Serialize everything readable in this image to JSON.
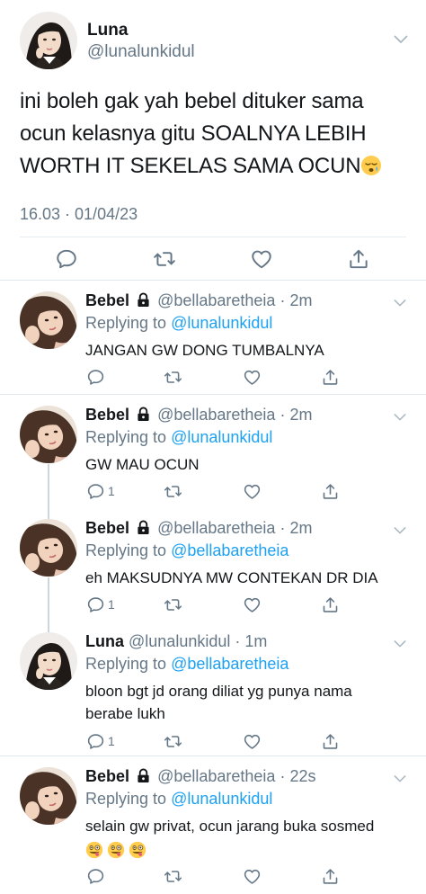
{
  "main_tweet": {
    "name": "Luna",
    "handle": "@lunalunkidul",
    "text_line1": "ini boleh gak yah bebel dituker sama",
    "text_line2": "ocun kelasnya gitu SOALNYA LEBIH",
    "text_line3": "WORTH IT SEKELAS SAMA OCUN",
    "timestamp": "16.03 · 01/04/23",
    "icons": [
      "reply-icon",
      "retweet-icon",
      "like-icon",
      "share-icon"
    ]
  },
  "replies": [
    {
      "name": "Bebel",
      "locked": true,
      "handle": "@bellabaretheia",
      "time": "· 2m",
      "replying_prefix": "Replying to ",
      "replying_to": "@lunalunkidul",
      "text": "JANGAN GW DONG TUMBALNYA",
      "reply_count": ""
    },
    {
      "name": "Bebel",
      "locked": true,
      "handle": "@bellabaretheia",
      "time": "· 2m",
      "replying_prefix": "Replying to ",
      "replying_to": "@lunalunkidul",
      "text": "GW MAU OCUN",
      "reply_count": "1"
    },
    {
      "name": "Bebel",
      "locked": true,
      "handle": "@bellabaretheia",
      "time": "· 2m",
      "replying_prefix": "Replying to ",
      "replying_to": "@bellabaretheia",
      "text": "eh MAKSUDNYA MW CONTEKAN DR DIA",
      "reply_count": "1"
    },
    {
      "name": "Luna",
      "locked": false,
      "handle": "@lunalunkidul",
      "time": "· 1m",
      "replying_prefix": "Replying to ",
      "replying_to": "@bellabaretheia",
      "text": "bloon bgt jd orang diliat yg punya nama",
      "text2": "berabe lukh",
      "reply_count": "1"
    },
    {
      "name": "Bebel",
      "locked": true,
      "handle": "@bellabaretheia",
      "time": "· 22s",
      "replying_prefix": "Replying to ",
      "replying_to": "@lunalunkidul",
      "text": "selain gw privat, ocun jarang buka sosmed",
      "reply_count": ""
    }
  ],
  "colors": {
    "link": "#1da1f2",
    "secondary_text": "#657786",
    "thread_line": "#ccd6dd",
    "divider": "#e1e8ed"
  }
}
